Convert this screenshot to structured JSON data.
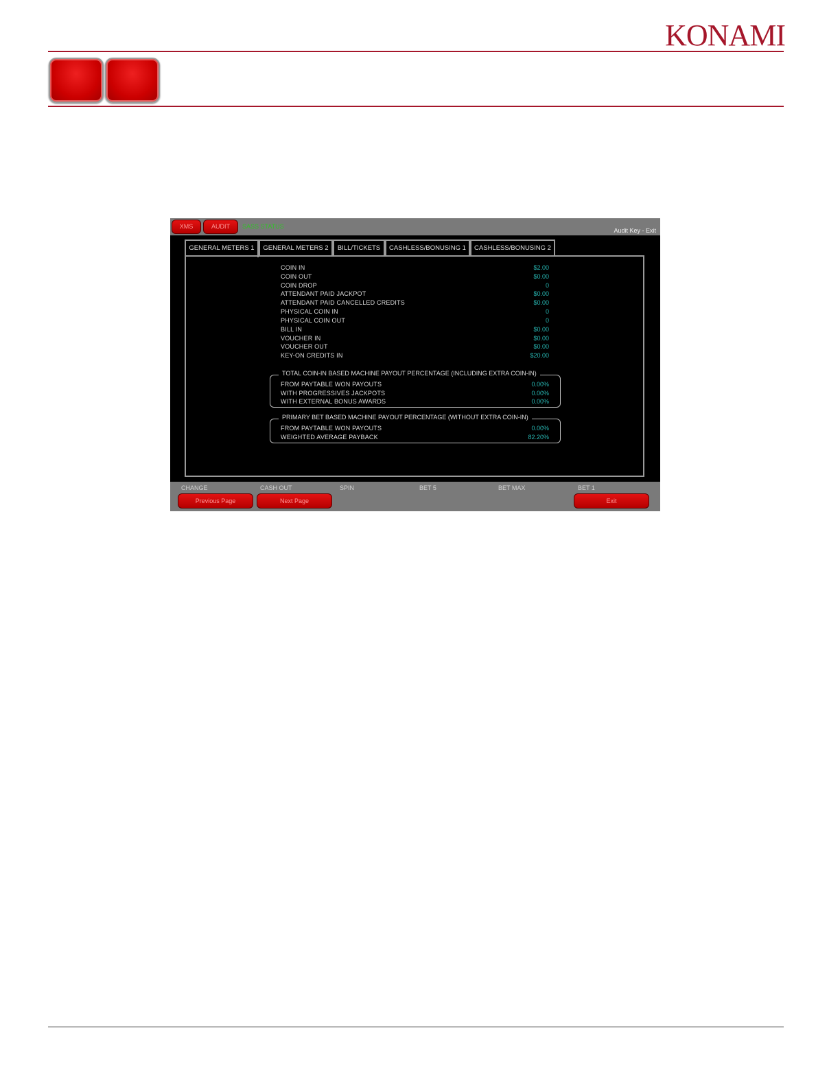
{
  "header": {
    "logo_text": "KONAMI",
    "brand_color": "#a5162a"
  },
  "screen": {
    "top_buttons": [
      "XMS",
      "AUDIT"
    ],
    "top_status": "SASS STATUS",
    "top_right": "Audit Key - Exit",
    "tabs": [
      "GENERAL METERS 1",
      "GENERAL METERS 2",
      "BILL/TICKETS",
      "CASHLESS/BONUSING 1",
      "CASHLESS/BONUSING 2"
    ],
    "active_tab": 0,
    "meters": [
      {
        "label": "COIN IN",
        "value": "$2.00"
      },
      {
        "label": "COIN OUT",
        "value": "$0.00"
      },
      {
        "label": "COIN DROP",
        "value": "0"
      },
      {
        "label": "ATTENDANT PAID JACKPOT",
        "value": "$0.00"
      },
      {
        "label": "ATTENDANT PAID CANCELLED CREDITS",
        "value": "$0.00"
      },
      {
        "label": "PHYSICAL COIN IN",
        "value": "0"
      },
      {
        "label": "PHYSICAL COIN OUT",
        "value": "0"
      },
      {
        "label": "BILL IN",
        "value": "$0.00"
      },
      {
        "label": "VOUCHER IN",
        "value": "$0.00"
      },
      {
        "label": "VOUCHER OUT",
        "value": "$0.00"
      },
      {
        "label": "KEY-ON CREDITS IN",
        "value": "$20.00"
      }
    ],
    "group1": {
      "title": "TOTAL COIN-IN BASED MACHINE PAYOUT PERCENTAGE (INCLUDING EXTRA COIN-IN)",
      "rows": [
        {
          "label": "FROM PAYTABLE WON PAYOUTS",
          "value": "0.00%"
        },
        {
          "label": "WITH PROGRESSIVES JACKPOTS",
          "value": "0.00%"
        },
        {
          "label": "WITH EXTERNAL BONUS AWARDS",
          "value": "0.00%"
        }
      ]
    },
    "group2": {
      "title": "PRIMARY BET BASED MACHINE PAYOUT PERCENTAGE (WITHOUT EXTRA COIN-IN)",
      "rows": [
        {
          "label": "FROM PAYTABLE WON PAYOUTS",
          "value": "0.00%"
        },
        {
          "label": "WEIGHTED AVERAGE PAYBACK",
          "value": "82.20%"
        }
      ]
    },
    "function_keys": [
      "CHANGE",
      "CASH OUT",
      "SPIN",
      "BET 5",
      "BET MAX",
      "BET 1"
    ],
    "bottom_buttons": {
      "previous": "Previous Page",
      "next": "Next Page",
      "exit": "Exit"
    }
  }
}
